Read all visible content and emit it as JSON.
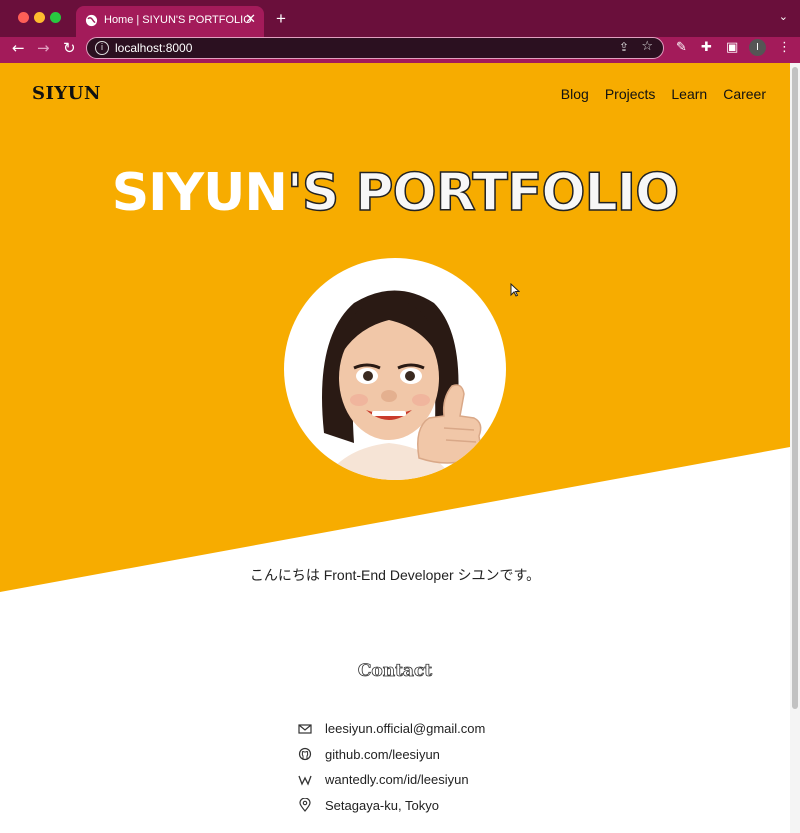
{
  "browser": {
    "tab_title": "Home | SIYUN'S PORTFOLIO",
    "tab_close": "✕",
    "new_tab": "+",
    "tab_menu": "⌄",
    "url": "localhost:8000",
    "profile_initial": "I",
    "colors": {
      "tabbar": "#6a0f3b",
      "toolbar": "#a31b5a"
    }
  },
  "site": {
    "logo": "SIYUN",
    "nav": [
      "Blog",
      "Projects",
      "Learn",
      "Career"
    ],
    "hero_title_part1": "SIYUN",
    "hero_title_part2": "'S PORTFOLIO",
    "greeting": "こんにちは Front-End Developer シユンです。",
    "colors": {
      "accent": "#f7ac00",
      "background": "#ffffff"
    }
  },
  "contact": {
    "title": "Contact",
    "items": [
      {
        "icon": "mail-icon",
        "text": "leesiyun.official@gmail.com"
      },
      {
        "icon": "github-icon",
        "text": "github.com/leesiyun"
      },
      {
        "icon": "wantedly-icon",
        "text": "wantedly.com/id/leesiyun"
      },
      {
        "icon": "location-pin-icon",
        "text": "Setagaya-ku, Tokyo"
      }
    ]
  }
}
